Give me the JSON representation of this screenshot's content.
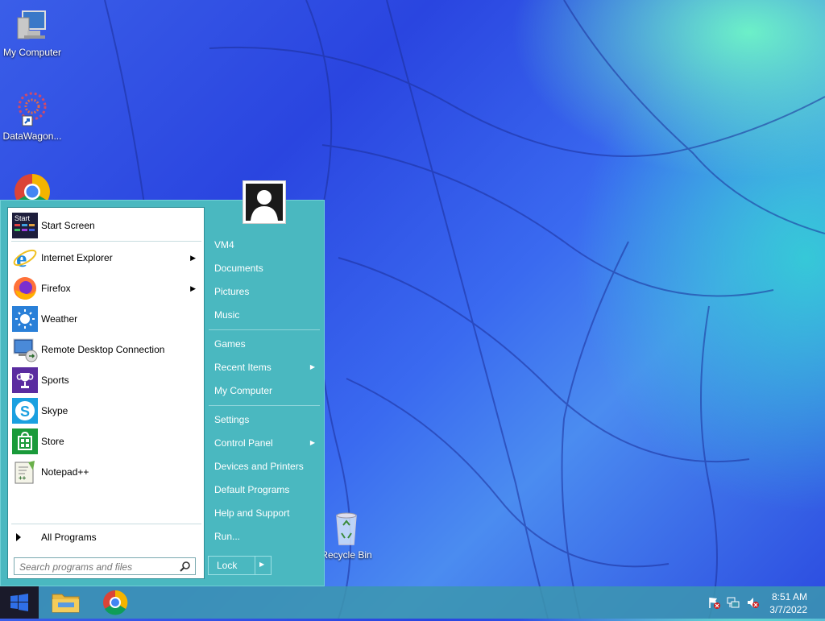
{
  "desktop": {
    "icons": [
      {
        "label": "My Computer"
      },
      {
        "label": "DataWagon..."
      },
      {
        "label": "Google Chrome"
      },
      {
        "label": "Recycle Bin"
      }
    ]
  },
  "start_menu": {
    "programs": [
      {
        "label": "Start Screen",
        "icon": "start-screen-icon"
      },
      {
        "label": "Internet Explorer",
        "icon": "internet-explorer-icon",
        "submenu": true
      },
      {
        "label": "Firefox",
        "icon": "firefox-icon",
        "submenu": true
      },
      {
        "label": "Weather",
        "icon": "weather-icon"
      },
      {
        "label": "Remote Desktop Connection",
        "icon": "remote-desktop-icon"
      },
      {
        "label": "Sports",
        "icon": "sports-trophy-icon"
      },
      {
        "label": "Skype",
        "icon": "skype-icon"
      },
      {
        "label": "Store",
        "icon": "store-icon"
      },
      {
        "label": "Notepad++",
        "icon": "notepad-plus-plus-icon"
      }
    ],
    "all_programs": "All Programs",
    "start_icon_text": "Start",
    "search_placeholder": "Search programs and files",
    "right_items": [
      {
        "label": "VM4"
      },
      {
        "label": "Documents"
      },
      {
        "label": "Pictures"
      },
      {
        "label": "Music"
      },
      {
        "label": "Games"
      },
      {
        "label": "Recent Items",
        "submenu": true
      },
      {
        "label": "My Computer"
      },
      {
        "label": "Settings"
      },
      {
        "label": "Control Panel",
        "submenu": true
      },
      {
        "label": "Devices and Printers"
      },
      {
        "label": "Default Programs"
      },
      {
        "label": "Help and Support"
      },
      {
        "label": "Run..."
      }
    ],
    "lock_label": "Lock"
  },
  "taskbar": {
    "time": "8:51 AM",
    "date": "3/7/2022",
    "pinned": [
      "file-explorer-icon",
      "chrome-icon"
    ]
  },
  "colors": {
    "menu_bg": "#4ab8c0",
    "taskbar": "#3c96af",
    "start_button": "#1a1a2a"
  }
}
